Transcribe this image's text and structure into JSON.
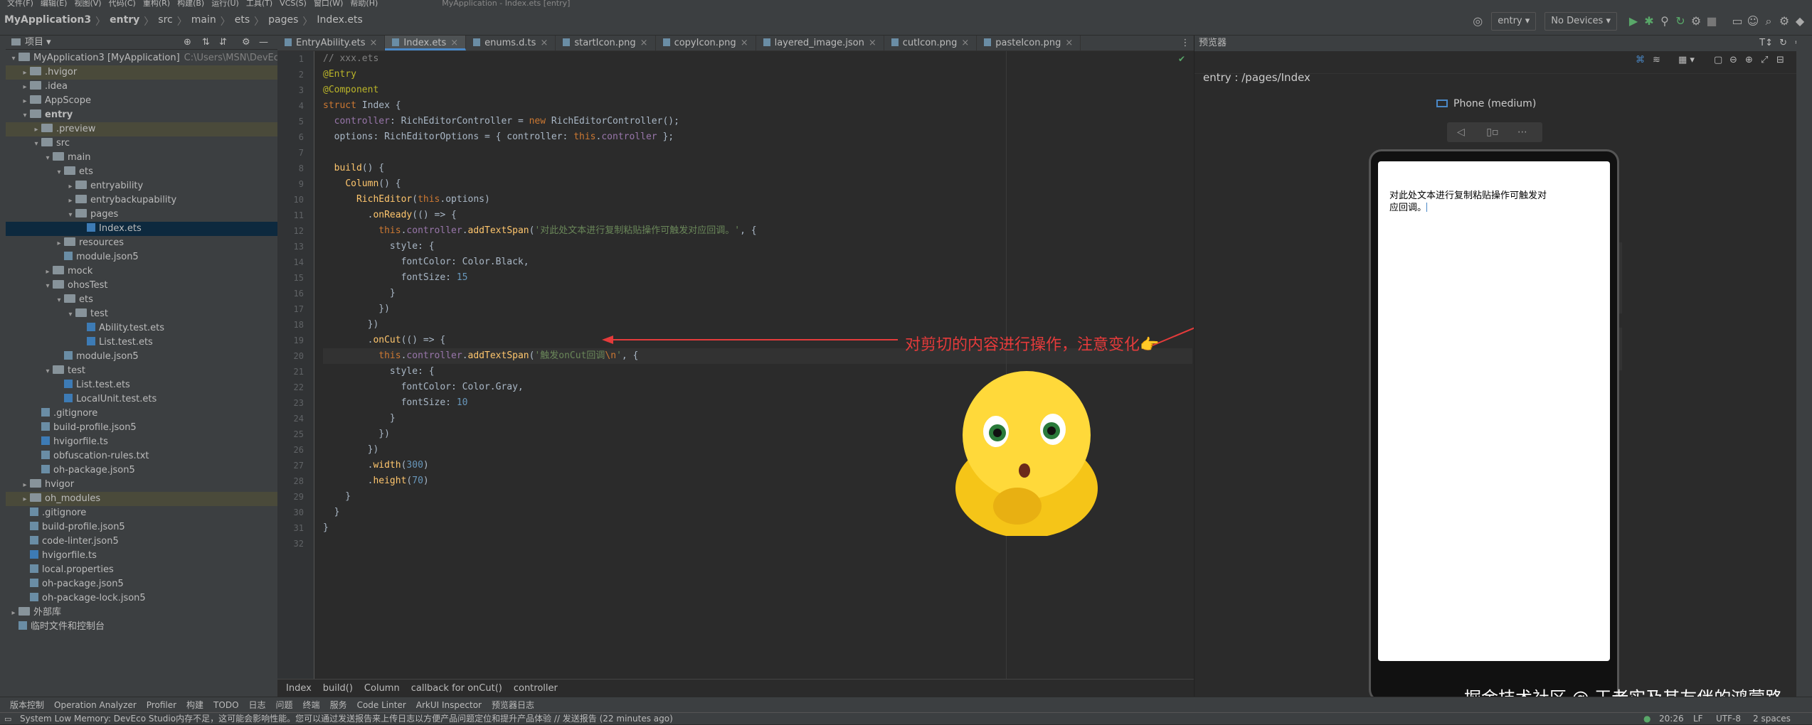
{
  "menu": {
    "items": [
      "文件(F)",
      "编辑(E)",
      "视图(V)",
      "代码(C)",
      "重构(R)",
      "构建(B)",
      "运行(U)",
      "工具(T)",
      "VCS(S)",
      "窗口(W)",
      "帮助(H)"
    ],
    "title": "MyApplication - Index.ets [entry]"
  },
  "nav": {
    "crumbs": [
      "MyApplication3",
      "entry",
      "src",
      "main",
      "ets",
      "pages",
      "Index.ets"
    ],
    "module": "entry",
    "device": "No Devices"
  },
  "project": {
    "label": "项目",
    "tree": [
      {
        "d": 0,
        "a": "▾",
        "i": "fold",
        "t": "MyApplication3 [MyApplication]",
        "extra": "C:\\Users\\MSN\\DevEco",
        "c": ""
      },
      {
        "d": 1,
        "a": "▸",
        "i": "fold",
        "t": ".hvigor",
        "c": "hl"
      },
      {
        "d": 1,
        "a": "▸",
        "i": "fold",
        "t": ".idea",
        "c": ""
      },
      {
        "d": 1,
        "a": "▸",
        "i": "fold",
        "t": "AppScope",
        "c": ""
      },
      {
        "d": 1,
        "a": "▾",
        "i": "fold",
        "t": "entry",
        "c": "",
        "b": true
      },
      {
        "d": 2,
        "a": "▸",
        "i": "fold",
        "t": ".preview",
        "c": "hl"
      },
      {
        "d": 2,
        "a": "▾",
        "i": "fold",
        "t": "src",
        "c": ""
      },
      {
        "d": 3,
        "a": "▾",
        "i": "fold",
        "t": "main",
        "c": ""
      },
      {
        "d": 4,
        "a": "▾",
        "i": "fold",
        "t": "ets",
        "c": ""
      },
      {
        "d": 5,
        "a": "▸",
        "i": "fold",
        "t": "entryability",
        "c": ""
      },
      {
        "d": 5,
        "a": "▸",
        "i": "fold",
        "t": "entrybackupability",
        "c": ""
      },
      {
        "d": 5,
        "a": "▾",
        "i": "fold",
        "t": "pages",
        "c": ""
      },
      {
        "d": 6,
        "a": "",
        "i": "ts",
        "t": "Index.ets",
        "c": "sel"
      },
      {
        "d": 4,
        "a": "▸",
        "i": "fold",
        "t": "resources",
        "c": ""
      },
      {
        "d": 4,
        "a": "",
        "i": "filei",
        "t": "module.json5",
        "c": ""
      },
      {
        "d": 3,
        "a": "▸",
        "i": "fold",
        "t": "mock",
        "c": ""
      },
      {
        "d": 3,
        "a": "▾",
        "i": "fold",
        "t": "ohosTest",
        "c": ""
      },
      {
        "d": 4,
        "a": "▾",
        "i": "fold",
        "t": "ets",
        "c": ""
      },
      {
        "d": 5,
        "a": "▾",
        "i": "fold",
        "t": "test",
        "c": ""
      },
      {
        "d": 6,
        "a": "",
        "i": "ts",
        "t": "Ability.test.ets",
        "c": ""
      },
      {
        "d": 6,
        "a": "",
        "i": "ts",
        "t": "List.test.ets",
        "c": ""
      },
      {
        "d": 4,
        "a": "",
        "i": "filei",
        "t": "module.json5",
        "c": ""
      },
      {
        "d": 3,
        "a": "▾",
        "i": "fold",
        "t": "test",
        "c": ""
      },
      {
        "d": 4,
        "a": "",
        "i": "ts",
        "t": "List.test.ets",
        "c": ""
      },
      {
        "d": 4,
        "a": "",
        "i": "ts",
        "t": "LocalUnit.test.ets",
        "c": ""
      },
      {
        "d": 2,
        "a": "",
        "i": "filei",
        "t": ".gitignore",
        "c": ""
      },
      {
        "d": 2,
        "a": "",
        "i": "filei",
        "t": "build-profile.json5",
        "c": ""
      },
      {
        "d": 2,
        "a": "",
        "i": "ts",
        "t": "hvigorfile.ts",
        "c": ""
      },
      {
        "d": 2,
        "a": "",
        "i": "filei",
        "t": "obfuscation-rules.txt",
        "c": ""
      },
      {
        "d": 2,
        "a": "",
        "i": "filei",
        "t": "oh-package.json5",
        "c": ""
      },
      {
        "d": 1,
        "a": "▸",
        "i": "fold",
        "t": "hvigor",
        "c": ""
      },
      {
        "d": 1,
        "a": "▸",
        "i": "fold",
        "t": "oh_modules",
        "c": "hl"
      },
      {
        "d": 1,
        "a": "",
        "i": "filei",
        "t": ".gitignore",
        "c": ""
      },
      {
        "d": 1,
        "a": "",
        "i": "filei",
        "t": "build-profile.json5",
        "c": ""
      },
      {
        "d": 1,
        "a": "",
        "i": "filei",
        "t": "code-linter.json5",
        "c": ""
      },
      {
        "d": 1,
        "a": "",
        "i": "ts",
        "t": "hvigorfile.ts",
        "c": ""
      },
      {
        "d": 1,
        "a": "",
        "i": "filei",
        "t": "local.properties",
        "c": ""
      },
      {
        "d": 1,
        "a": "",
        "i": "filei",
        "t": "oh-package.json5",
        "c": ""
      },
      {
        "d": 1,
        "a": "",
        "i": "filei",
        "t": "oh-package-lock.json5",
        "c": ""
      },
      {
        "d": 0,
        "a": "▸",
        "i": "fold",
        "t": "外部库",
        "c": ""
      },
      {
        "d": 0,
        "a": "",
        "i": "filei",
        "t": "临时文件和控制台",
        "c": ""
      }
    ]
  },
  "editor": {
    "tabs": [
      {
        "t": "EntryAbility.ets",
        "act": false
      },
      {
        "t": "Index.ets",
        "act": true
      },
      {
        "t": "enums.d.ts",
        "act": false
      },
      {
        "t": "startIcon.png",
        "act": false
      },
      {
        "t": "copyIcon.png",
        "act": false
      },
      {
        "t": "layered_image.json",
        "act": false
      },
      {
        "t": "cutIcon.png",
        "act": false
      },
      {
        "t": "pasteIcon.png",
        "act": false
      }
    ],
    "current_line": 20,
    "breadcrumbs": [
      "Index",
      "build()",
      "Column",
      "callback for onCut()",
      "controller"
    ],
    "annotation": "对剪切的内容进行操作，注意变化👉"
  },
  "code_lines": [
    [
      [
        "cm",
        "// xxx.ets"
      ]
    ],
    [
      [
        "ann",
        "@Entry"
      ]
    ],
    [
      [
        "ann",
        "@Component"
      ]
    ],
    [
      [
        "kw",
        "struct "
      ],
      [
        "pl",
        "Index {"
      ]
    ],
    [
      [
        "pl",
        "  "
      ],
      [
        "pr",
        "controller"
      ],
      [
        "pl",
        ": RichEditorController = "
      ],
      [
        "kw",
        "new "
      ],
      [
        "pl",
        "RichEditorController();"
      ]
    ],
    [
      [
        "pl",
        "  options: RichEditorOptions = { controller: "
      ],
      [
        "kw",
        "this"
      ],
      [
        "pl",
        "."
      ],
      [
        "pr",
        "controller"
      ],
      [
        "pl",
        " };"
      ]
    ],
    [
      [
        "pl",
        ""
      ]
    ],
    [
      [
        "pl",
        "  "
      ],
      [
        "fn",
        "build"
      ],
      [
        "pl",
        "() {"
      ]
    ],
    [
      [
        "pl",
        "    "
      ],
      [
        "fn",
        "Column"
      ],
      [
        "pl",
        "() {"
      ]
    ],
    [
      [
        "pl",
        "      "
      ],
      [
        "fn",
        "RichEditor"
      ],
      [
        "pl",
        "("
      ],
      [
        "kw",
        "this"
      ],
      [
        "pl",
        ".options)"
      ]
    ],
    [
      [
        "pl",
        "        ."
      ],
      [
        "fn",
        "onReady"
      ],
      [
        "pl",
        "(() => {"
      ]
    ],
    [
      [
        "pl",
        "          "
      ],
      [
        "kw",
        "this"
      ],
      [
        "pl",
        "."
      ],
      [
        "pr",
        "controller"
      ],
      [
        "pl",
        "."
      ],
      [
        "fn",
        "addTextSpan"
      ],
      [
        "pl",
        "("
      ],
      [
        "str",
        "'对此处文本进行复制粘贴操作可触发对应回调。'"
      ],
      [
        "pl",
        ", {"
      ]
    ],
    [
      [
        "pl",
        "            style: {"
      ]
    ],
    [
      [
        "pl",
        "              fontColor: Color.Black,"
      ]
    ],
    [
      [
        "pl",
        "              fontSize: "
      ],
      [
        "num",
        "15"
      ]
    ],
    [
      [
        "pl",
        "            }"
      ]
    ],
    [
      [
        "pl",
        "          })"
      ]
    ],
    [
      [
        "pl",
        "        })"
      ]
    ],
    [
      [
        "pl",
        "        ."
      ],
      [
        "fn",
        "onCut"
      ],
      [
        "pl",
        "(() => {"
      ]
    ],
    [
      [
        "pl",
        "          "
      ],
      [
        "kw",
        "this"
      ],
      [
        "pl",
        "."
      ],
      [
        "pr",
        "controller"
      ],
      [
        "pl",
        "."
      ],
      [
        "fn",
        "addTextSpan"
      ],
      [
        "pl",
        "("
      ],
      [
        "str",
        "'触发onCut回调"
      ],
      [
        "kw",
        "\\n"
      ],
      [
        "str",
        "'"
      ],
      [
        "pl",
        ", {"
      ]
    ],
    [
      [
        "pl",
        "            style: {"
      ]
    ],
    [
      [
        "pl",
        "              fontColor: Color.Gray,"
      ]
    ],
    [
      [
        "pl",
        "              fontSize: "
      ],
      [
        "num",
        "10"
      ]
    ],
    [
      [
        "pl",
        "            }"
      ]
    ],
    [
      [
        "pl",
        "          })"
      ]
    ],
    [
      [
        "pl",
        "        })"
      ]
    ],
    [
      [
        "pl",
        "        ."
      ],
      [
        "fn",
        "width"
      ],
      [
        "pl",
        "("
      ],
      [
        "num",
        "300"
      ],
      [
        "pl",
        ")"
      ]
    ],
    [
      [
        "pl",
        "        ."
      ],
      [
        "fn",
        "height"
      ],
      [
        "pl",
        "("
      ],
      [
        "num",
        "70"
      ],
      [
        "pl",
        ")"
      ]
    ],
    [
      [
        "pl",
        "    }"
      ]
    ],
    [
      [
        "pl",
        "  }"
      ]
    ],
    [
      [
        "pl",
        "}"
      ]
    ],
    [
      [
        "pl",
        ""
      ]
    ]
  ],
  "preview": {
    "title": "预览器",
    "path": "entry : /pages/Index",
    "device": "Phone (medium)",
    "phone_text_1": "对此处文本进行复制粘贴操作可触发对",
    "phone_text_2": "应回调。"
  },
  "bottom_tabs": [
    "版本控制",
    "Operation Analyzer",
    "Profiler",
    "构建",
    "TODO",
    "日志",
    "问题",
    "终端",
    "服务",
    "Code Linter",
    "ArkUI Inspector",
    "预览器日志"
  ],
  "status": {
    "message": "System Low Memory: DevEco Studio内存不足，这可能会影响性能。您可以通过发送报告来上传日志以方便产品问题定位和提升产品体验 // 发送报告 (22 minutes ago)",
    "position": "20:26",
    "eol": "LF",
    "encoding": "UTF-8",
    "indent": "2 spaces"
  },
  "watermark": "掘金技术社区 @ 王老实及其友伴的鸿蒙路",
  "colors": {
    "bg": "#2b2b2b",
    "panel": "#3c3f41",
    "arrow": "#e53b3b",
    "accent": "#4a88c7"
  }
}
